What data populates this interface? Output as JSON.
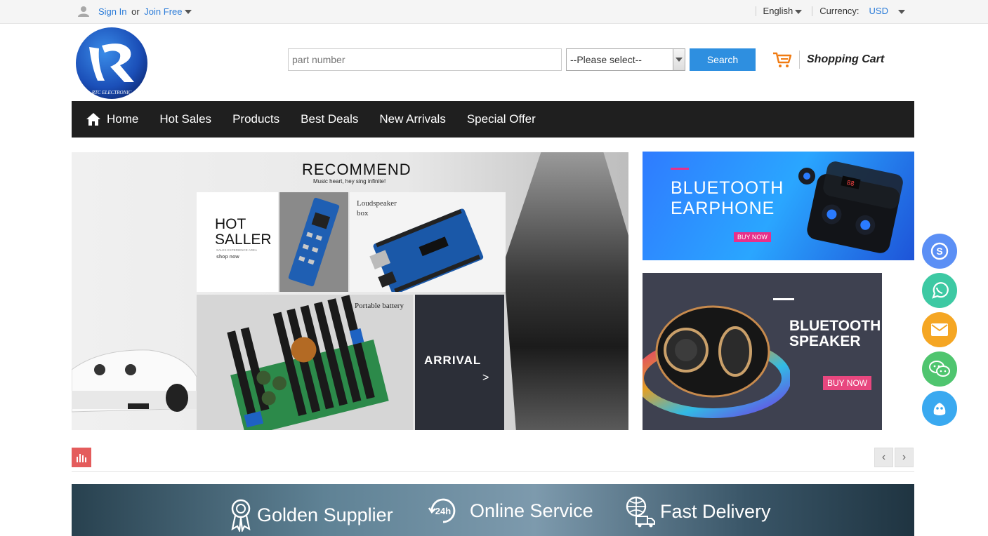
{
  "topbar": {
    "sign_in": "Sign In",
    "or": "or",
    "join_free": "Join Free",
    "language": "English",
    "currency_label": "Currency:",
    "currency_value": "USD"
  },
  "header": {
    "logo_text": "RTC ELECTRONIC",
    "search_placeholder": "part number",
    "category_select": "--Please select--",
    "search_button": "Search",
    "cart_label": "Shopping Cart"
  },
  "nav": {
    "items": [
      "Home",
      "Hot Sales",
      "Products",
      "Best Deals",
      "New Arrivals",
      "Special Offer"
    ]
  },
  "banner": {
    "title": "RECOMMEND",
    "subtitle": "Music heart, hey sing infinite!",
    "hot_line1": "HOT",
    "hot_line2": "SALLER",
    "hot_small": "SALES EXPERIENCE AREA",
    "hot_link": "shop now",
    "loudspeaker": "Loudspeaker",
    "loudspeaker2": "box",
    "portable": "Portable battery",
    "arrival": "ARRIVAL",
    "arrival_arrow": ">"
  },
  "side_banners": {
    "earphone_line1": "BLUETOOTH",
    "earphone_line2": "EARPHONE",
    "earphone_btn": "BUY NOW",
    "earphone_display": "88",
    "speaker_line1": "BLUETOOTH",
    "speaker_line2": "SPEAKER",
    "speaker_btn": "BUY NOW"
  },
  "features": {
    "items": [
      "Golden Supplier",
      "Online Service",
      "Fast Delivery"
    ],
    "badge_24h": "24h"
  },
  "social": {
    "colors": [
      "#5b8ff5",
      "#3dc9a3",
      "#f5a623",
      "#4fc56f",
      "#3aa9f0"
    ],
    "icons": [
      "skype-icon",
      "whatsapp-icon",
      "email-icon",
      "wechat-icon",
      "qq-icon"
    ]
  }
}
